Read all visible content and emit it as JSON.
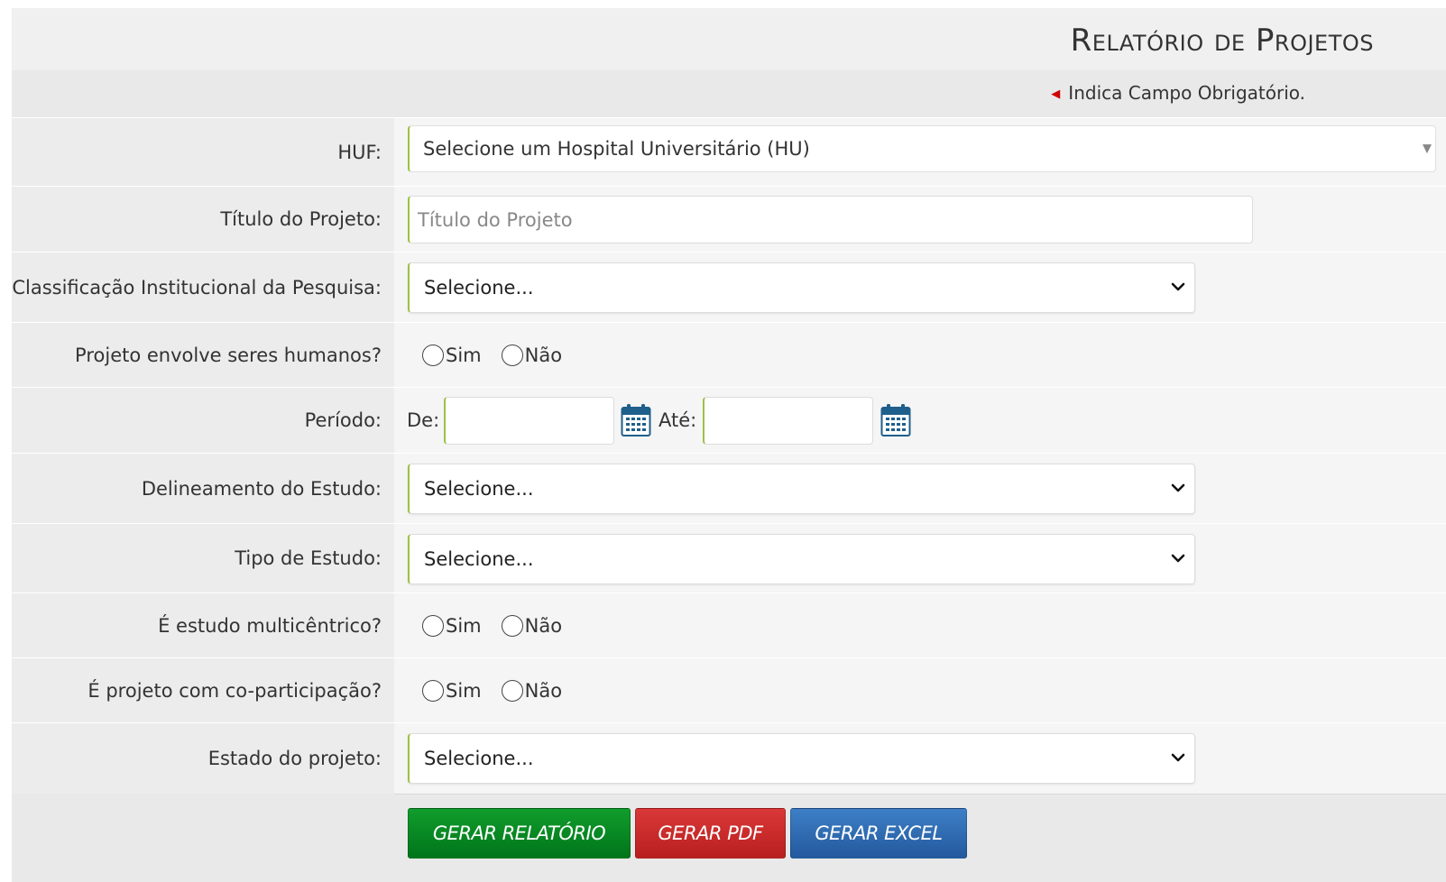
{
  "header": {
    "title": "Relatório de Projetos",
    "required_note": "Indica Campo Obrigatório."
  },
  "form": {
    "huf": {
      "label": "HUF:",
      "value": "Selecione um Hospital Universitário (HU)"
    },
    "titulo": {
      "label": "Título do Projeto:",
      "placeholder": "Título do Projeto",
      "value": ""
    },
    "classificacao": {
      "label": "Classificação Institucional da Pesquisa:",
      "value": "Selecione..."
    },
    "seres_humanos": {
      "label": "Projeto envolve seres humanos?",
      "options": [
        "Sim",
        "Não"
      ]
    },
    "periodo": {
      "label": "Período:",
      "from_label": "De:",
      "to_label": "Até:",
      "from_value": "",
      "to_value": ""
    },
    "delineamento": {
      "label": "Delineamento do Estudo:",
      "value": "Selecione..."
    },
    "tipo_estudo": {
      "label": "Tipo de Estudo:",
      "value": "Selecione..."
    },
    "multicentrico": {
      "label": "É estudo multicêntrico?",
      "options": [
        "Sim",
        "Não"
      ]
    },
    "coparticipacao": {
      "label": "É projeto com co-participação?",
      "options": [
        "Sim",
        "Não"
      ]
    },
    "estado": {
      "label": "Estado do projeto:",
      "value": "Selecione..."
    }
  },
  "actions": {
    "gerar_relatorio": "GERAR RELATÓRIO",
    "gerar_pdf": "GERAR PDF",
    "gerar_excel": "GERAR EXCEL"
  },
  "colors": {
    "required_mark": "#d00000",
    "field_accent": "#9bc246",
    "calendar_icon": "#1f5f8b",
    "btn_green": "#00751b",
    "btn_red": "#c62828",
    "btn_blue": "#2b66ac"
  }
}
